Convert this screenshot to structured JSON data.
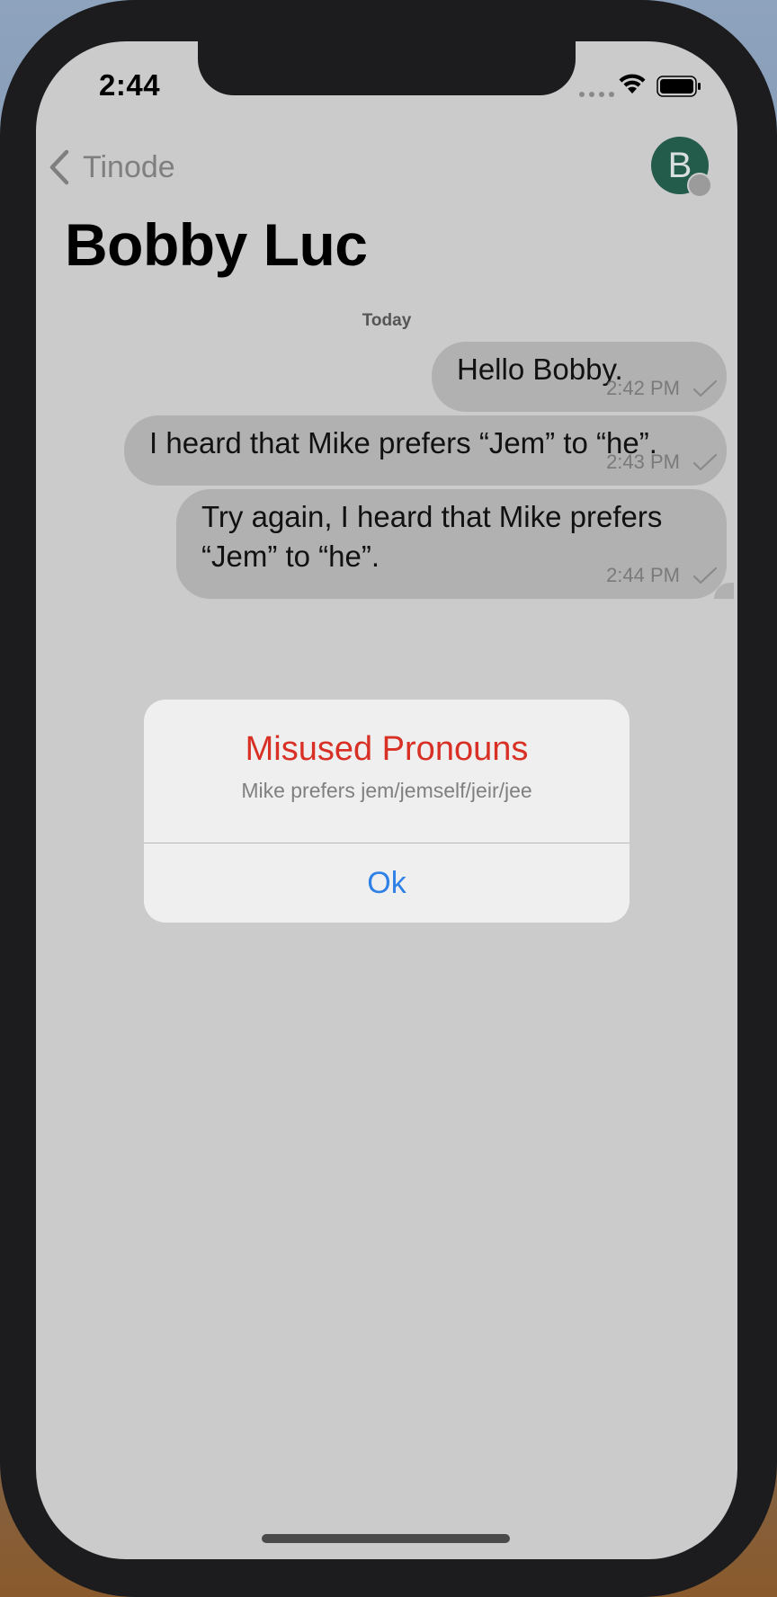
{
  "status_bar": {
    "time": "2:44"
  },
  "nav": {
    "back_label": "Tinode",
    "avatar_initial": "B"
  },
  "chat": {
    "title": "Bobby Luc",
    "day_label": "Today",
    "messages": [
      {
        "text": "Hello Bobby.",
        "time": "2:42 PM"
      },
      {
        "text": "I heard that Mike prefers “Jem” to “he”.",
        "time": "2:43 PM"
      },
      {
        "text": "Try again, I heard that Mike prefers “Jem” to “he”.",
        "time": "2:44 PM"
      }
    ]
  },
  "alert": {
    "title": "Misused Pronouns",
    "message": "Mike prefers jem/jemself/jeir/jee",
    "ok_label": "Ok"
  },
  "colors": {
    "alert_title": "#d93025",
    "action_blue": "#2f80e7",
    "avatar_bg": "#245c4c",
    "bubble_bg": "#b1b1b1",
    "screen_dim": "#cbcbcb"
  },
  "icons": {
    "back": "chevron-left-icon",
    "wifi": "wifi-icon",
    "battery": "battery-icon",
    "read_receipt": "checkmark-icon"
  }
}
